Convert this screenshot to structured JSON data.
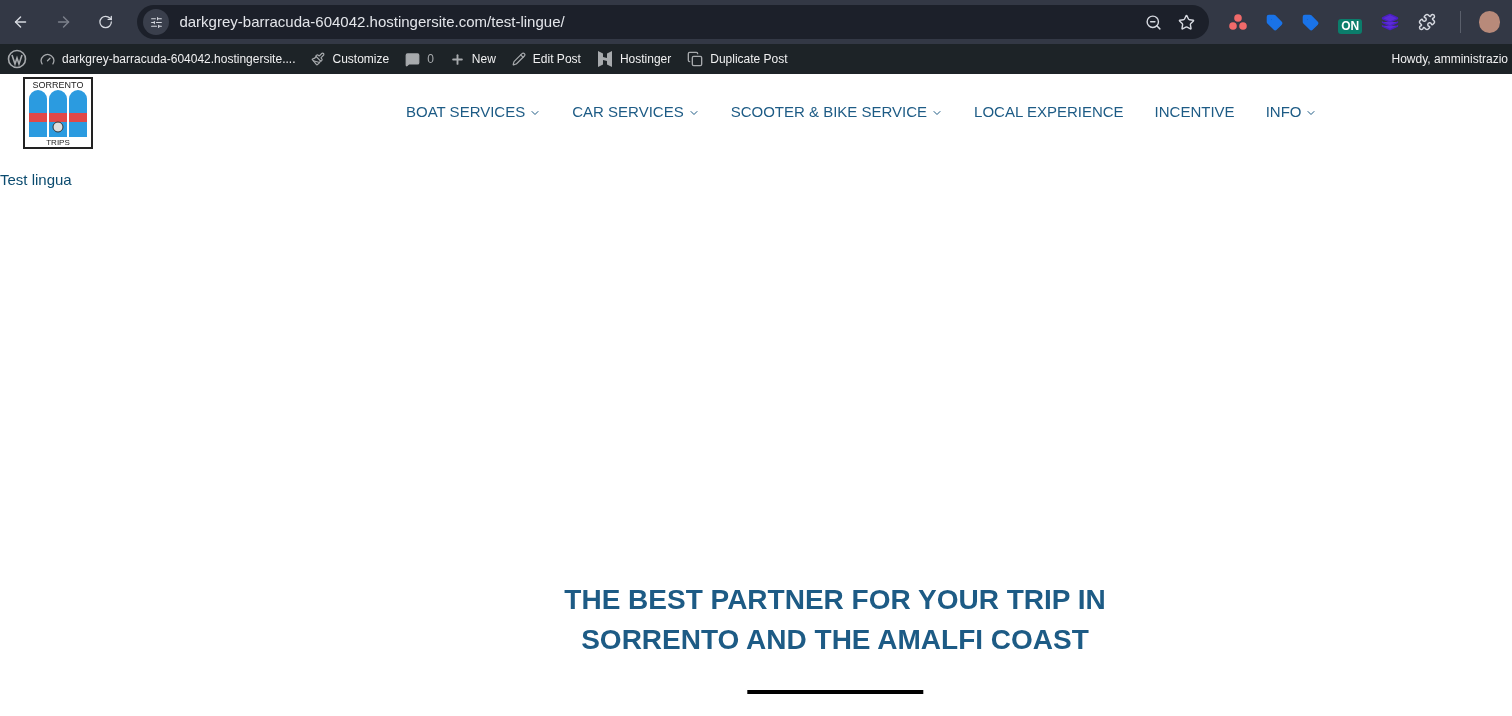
{
  "browser": {
    "url": "darkgrey-barracuda-604042.hostingersite.com/test-lingue/",
    "extensions": [
      {
        "kind": "dots"
      },
      {
        "kind": "tag"
      },
      {
        "kind": "tag"
      },
      {
        "kind": "on",
        "label": "ON"
      },
      {
        "kind": "layers"
      },
      {
        "kind": "puzzle"
      }
    ]
  },
  "admin_bar": {
    "items": [
      {
        "kind": "wp"
      },
      {
        "kind": "site",
        "label": "darkgrey-barracuda-604042.hostingersite...."
      },
      {
        "kind": "customize",
        "label": "Customize"
      },
      {
        "kind": "comments",
        "label": "0"
      },
      {
        "kind": "new",
        "label": "New"
      },
      {
        "kind": "edit",
        "label": "Edit Post"
      },
      {
        "kind": "hostinger",
        "label": "Hostinger"
      },
      {
        "kind": "duplicate",
        "label": "Duplicate Post"
      }
    ],
    "greeting": "Howdy, amministrazio"
  },
  "logo": {
    "top": "SORRENTO",
    "bottom": "TRIPS"
  },
  "nav": [
    {
      "label": "BOAT SERVICES",
      "has_dropdown": true
    },
    {
      "label": "CAR SERVICES",
      "has_dropdown": true
    },
    {
      "label": "SCOOTER & BIKE SERVICE",
      "has_dropdown": true
    },
    {
      "label": "LOCAL EXPERIENCE",
      "has_dropdown": false
    },
    {
      "label": "INCENTIVE",
      "has_dropdown": false
    },
    {
      "label": "INFO",
      "has_dropdown": true
    }
  ],
  "page_title": "Test lingua",
  "hero": {
    "heading_lines": [
      "THE BEST PARTNER FOR YOUR TRIP IN",
      "SORRENTO AND THE AMALFI COAST"
    ]
  }
}
